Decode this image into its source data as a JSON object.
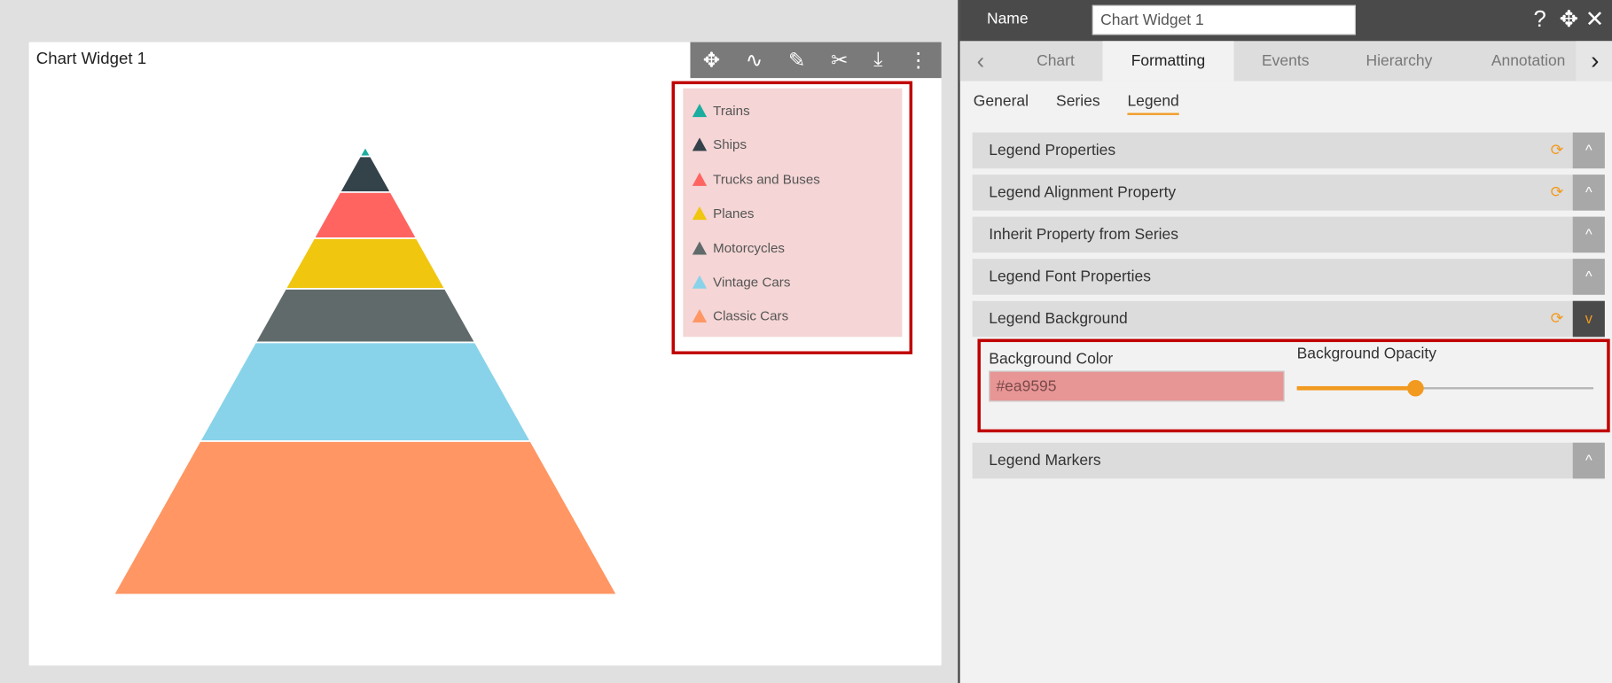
{
  "widget": {
    "title": "Chart Widget 1",
    "toolbar_icons": [
      "move-icon",
      "draw-icon",
      "edit-icon",
      "tools-icon",
      "download-icon",
      "more-icon"
    ]
  },
  "chart_data": {
    "type": "pyramid",
    "categories": [
      "Trains",
      "Ships",
      "Trucks and Buses",
      "Planes",
      "Motorcycles",
      "Vintage Cars",
      "Classic Cars"
    ],
    "values": [
      9,
      34,
      44,
      48,
      51,
      94,
      146
    ],
    "colors": [
      "#1aada0",
      "#34424a",
      "#ff6461",
      "#f0c60f",
      "#606a6b",
      "#88d3ea",
      "#ff9663"
    ],
    "legend": {
      "position": "top-right",
      "background": "#ea9595"
    }
  },
  "panel": {
    "name_label": "Name",
    "name_value": "Chart Widget 1",
    "tabs": [
      {
        "label": "Chart"
      },
      {
        "label": "Formatting"
      },
      {
        "label": "Events"
      },
      {
        "label": "Hierarchy"
      },
      {
        "label": "Annotation"
      }
    ],
    "subtabs": [
      {
        "label": "General"
      },
      {
        "label": "Series"
      },
      {
        "label": "Legend"
      }
    ],
    "sections": [
      {
        "label": "Legend Properties"
      },
      {
        "label": "Legend Alignment Property"
      },
      {
        "label": "Inherit Property from Series"
      },
      {
        "label": "Legend Font Properties"
      },
      {
        "label": "Legend Background"
      },
      {
        "label": "Legend Markers"
      }
    ],
    "bg_color_label": "Background Color",
    "bg_color_value": "#ea9595",
    "bg_opacity_label": "Background Opacity",
    "bg_opacity": 0.4,
    "accent": "#f29a1f"
  }
}
